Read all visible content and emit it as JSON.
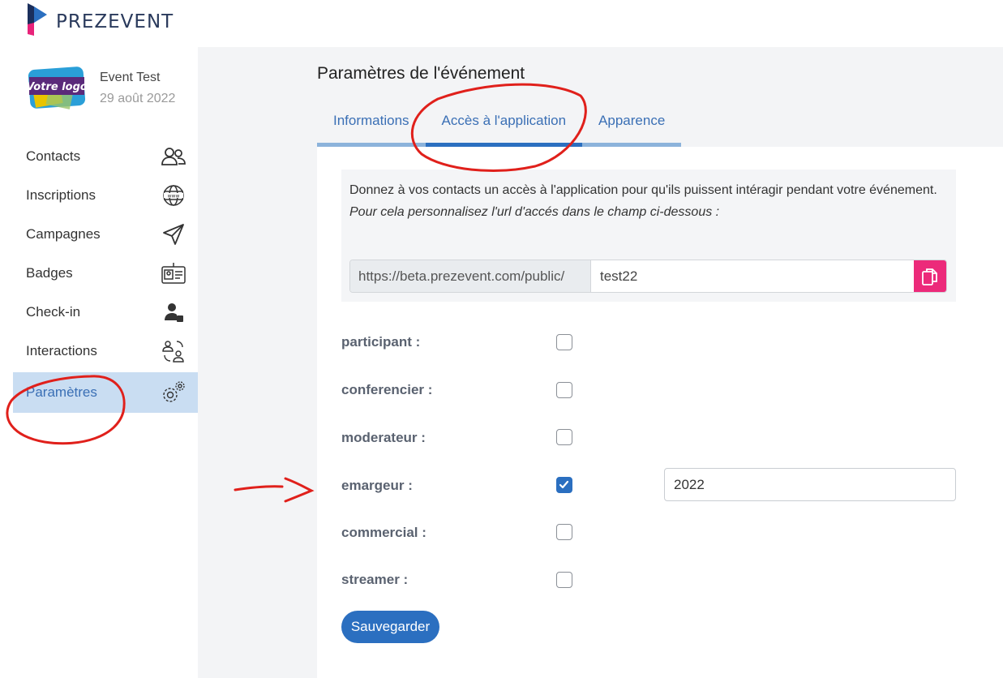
{
  "brand": {
    "name": "PREZEVENT",
    "colors": [
      "#e8237a",
      "#2b6fc0",
      "#1b2f5c"
    ]
  },
  "event": {
    "logo_text": "Votre logo",
    "name": "Event Test",
    "date": "29 août 2022"
  },
  "sidebar": {
    "items": [
      {
        "label": "Contacts",
        "icon": "contacts-icon"
      },
      {
        "label": "Inscriptions",
        "icon": "globe-www-icon"
      },
      {
        "label": "Campagnes",
        "icon": "paper-plane-icon"
      },
      {
        "label": "Badges",
        "icon": "id-badge-icon"
      },
      {
        "label": "Check-in",
        "icon": "user-check-icon"
      },
      {
        "label": "Interactions",
        "icon": "interactions-icon"
      },
      {
        "label": "Paramètres",
        "icon": "gears-icon",
        "active": true
      }
    ]
  },
  "main": {
    "title": "Paramètres de l'événement",
    "tabs": [
      {
        "label": "Informations"
      },
      {
        "label": "Accès à l'application",
        "active": true
      },
      {
        "label": "Apparence"
      }
    ],
    "info": {
      "line1": "Donnez à vos contacts un accès à l'application pour qu'ils puissent intéragir pendant votre événement.",
      "line2": "Pour cela personnalisez l'url d'accés dans le champ ci-dessous :"
    },
    "url": {
      "prefix": "https://beta.prezevent.com/public/",
      "value": "test22"
    },
    "roles": [
      {
        "label": "participant :",
        "checked": false
      },
      {
        "label": "conferencier :",
        "checked": false
      },
      {
        "label": "moderateur :",
        "checked": false
      },
      {
        "label": "emargeur :",
        "checked": true,
        "value": "2022"
      },
      {
        "label": "commercial :",
        "checked": false
      },
      {
        "label": "streamer :",
        "checked": false
      }
    ],
    "save_label": "Sauvegarder"
  },
  "colors": {
    "accent": "#2b6fc0",
    "active_bg": "#c9ddf2",
    "copy_button": "#ec2a7a",
    "annotation": "#e0201b"
  }
}
